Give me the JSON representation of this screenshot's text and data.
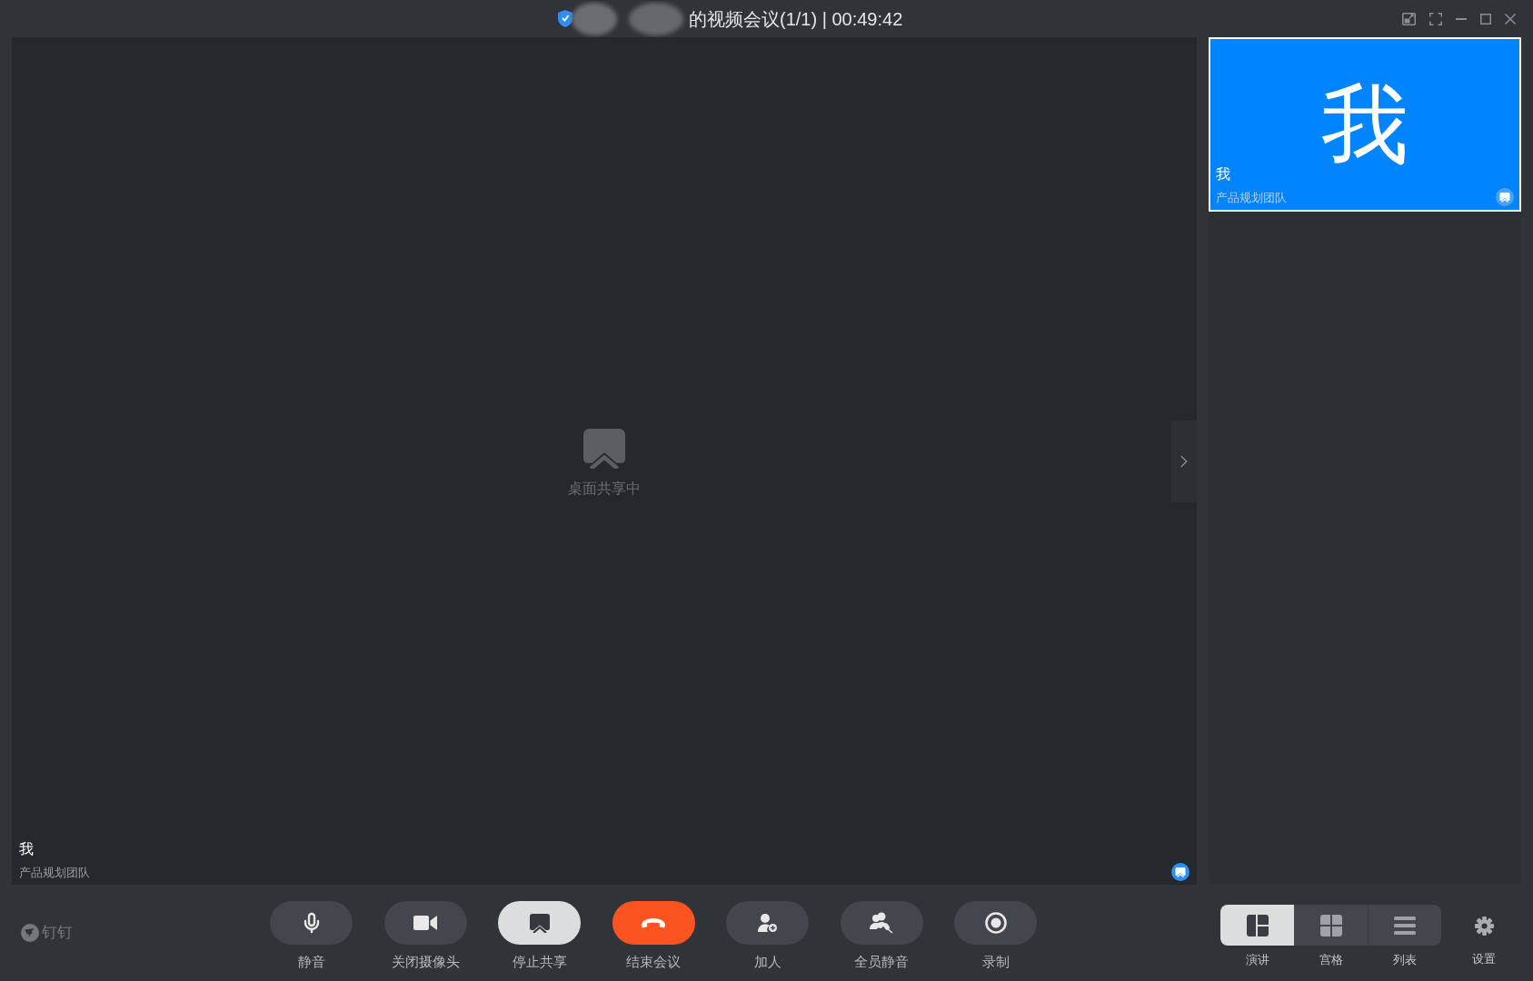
{
  "window": {
    "title": "的视频会议(1/1) | 00:49:42"
  },
  "stage": {
    "status": "桌面共享中",
    "name": "我",
    "team": "产品规划团队"
  },
  "participants": [
    {
      "avatar": "我",
      "name": "我",
      "team": "产品规划团队",
      "selected": true
    }
  ],
  "toolbar": {
    "brand": "钉钉",
    "buttons": [
      {
        "kind": "mic",
        "label": "静音"
      },
      {
        "kind": "camera",
        "label": "关闭摄像头"
      },
      {
        "kind": "stop_share",
        "label": "停止共享"
      },
      {
        "kind": "end",
        "label": "结束会议"
      },
      {
        "kind": "add",
        "label": "加人"
      },
      {
        "kind": "mute_all",
        "label": "全员静音"
      },
      {
        "kind": "record",
        "label": "录制"
      }
    ],
    "views": [
      {
        "kind": "speaker",
        "label": "演讲",
        "selected": true
      },
      {
        "kind": "grid",
        "label": "宫格",
        "selected": false
      },
      {
        "kind": "list",
        "label": "列表",
        "selected": false
      }
    ],
    "settings": {
      "label": "设置"
    }
  }
}
